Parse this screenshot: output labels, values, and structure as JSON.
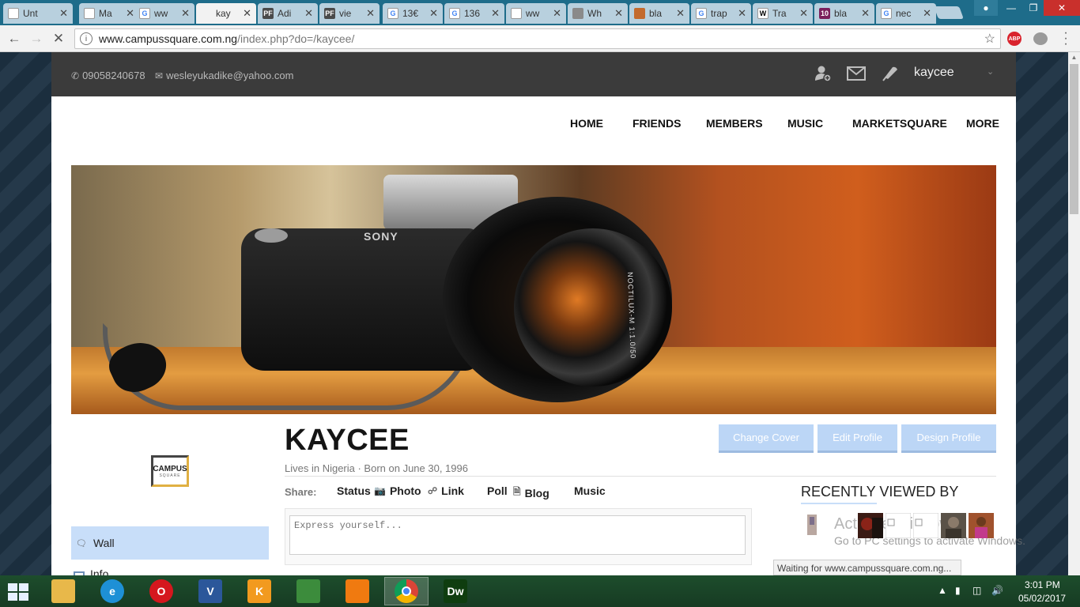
{
  "browser": {
    "tabs": [
      {
        "label": "Unt",
        "icon": "doc-icon"
      },
      {
        "label": "Ma",
        "icon": "doc-icon"
      },
      {
        "label": "ww",
        "icon": "google-icon"
      },
      {
        "label": "kay",
        "icon": "loading-icon",
        "active": true
      },
      {
        "label": "Adi",
        "icon": "pf-icon"
      },
      {
        "label": "vie",
        "icon": "pf-icon"
      },
      {
        "label": "13€",
        "icon": "google-icon"
      },
      {
        "label": "136",
        "icon": "google-icon"
      },
      {
        "label": "ww",
        "icon": "doc-icon"
      },
      {
        "label": "Wh",
        "icon": "wh-icon"
      },
      {
        "label": "bla",
        "icon": "bla-icon"
      },
      {
        "label": "trap",
        "icon": "google-icon"
      },
      {
        "label": "Tra",
        "icon": "wikipedia-icon"
      },
      {
        "label": "bla",
        "icon": "ten-icon"
      },
      {
        "label": "nec",
        "icon": "google-icon"
      }
    ],
    "tab_icon_letters": {
      "pf": "PF",
      "wiki": "W",
      "ten": "10",
      "google": "G"
    },
    "close_glyph": "✕",
    "url_host": "www.campussquare.com.ng",
    "url_path": "/index.php?do=/kaycee/",
    "abp_label": "ABP"
  },
  "site": {
    "phone": "09058240678",
    "email": "wesleyukadike@yahoo.com",
    "username": "kaycee",
    "nav": [
      "HOME",
      "FRIENDS",
      "MEMBERS",
      "MUSIC",
      "MARKETSQUARE",
      "MORE"
    ],
    "cover_brand": "SONY",
    "cover_lens_mark": "NOCTILUX-M 1:1.0/50",
    "logo_line1": "CAMPUS",
    "logo_line2": "SQUARE",
    "profile_name": "KAYCEE",
    "profile_sub": "Lives in Nigeria · Born on June 30, 1996",
    "buttons": {
      "change_cover": "Change Cover",
      "edit_profile": "Edit Profile",
      "design_profile": "Design Profile"
    },
    "share_label": "Share:",
    "share_items": [
      "Status",
      "Photo",
      "Link",
      "Poll",
      "Blog",
      "Music"
    ],
    "composer_placeholder": "Express yourself...",
    "sidebar": {
      "wall": "Wall",
      "info": "Info"
    },
    "recent_title": "RECENTLY VIEWED BY",
    "activate_line1": "Activate Windows",
    "activate_line2": "Go to PC settings to activate Windows.",
    "status_text": "Waiting for www.campussquare.com.ng..."
  },
  "taskbar": {
    "time": "3:01 PM",
    "date": "05/02/2017",
    "apps": [
      {
        "name": "file-explorer-icon",
        "color": "#e8b84a",
        "glyph": ""
      },
      {
        "name": "internet-explorer-icon",
        "color": "#1e90d6",
        "glyph": "e"
      },
      {
        "name": "opera-icon",
        "color": "#d5171e",
        "glyph": "O"
      },
      {
        "name": "visio-icon",
        "color": "#2b579a",
        "glyph": "V"
      },
      {
        "name": "k13-icon",
        "color": "#f29a1f",
        "glyph": "K"
      },
      {
        "name": "idm-icon",
        "color": "#3c8c3c",
        "glyph": ""
      },
      {
        "name": "vlc-icon",
        "color": "#f07a10",
        "glyph": ""
      },
      {
        "name": "chrome-icon",
        "color": "#dd4b39",
        "glyph": "",
        "active": true
      },
      {
        "name": "dreamweaver-icon",
        "color": "#0f3d0f",
        "glyph": "Dw"
      }
    ]
  }
}
